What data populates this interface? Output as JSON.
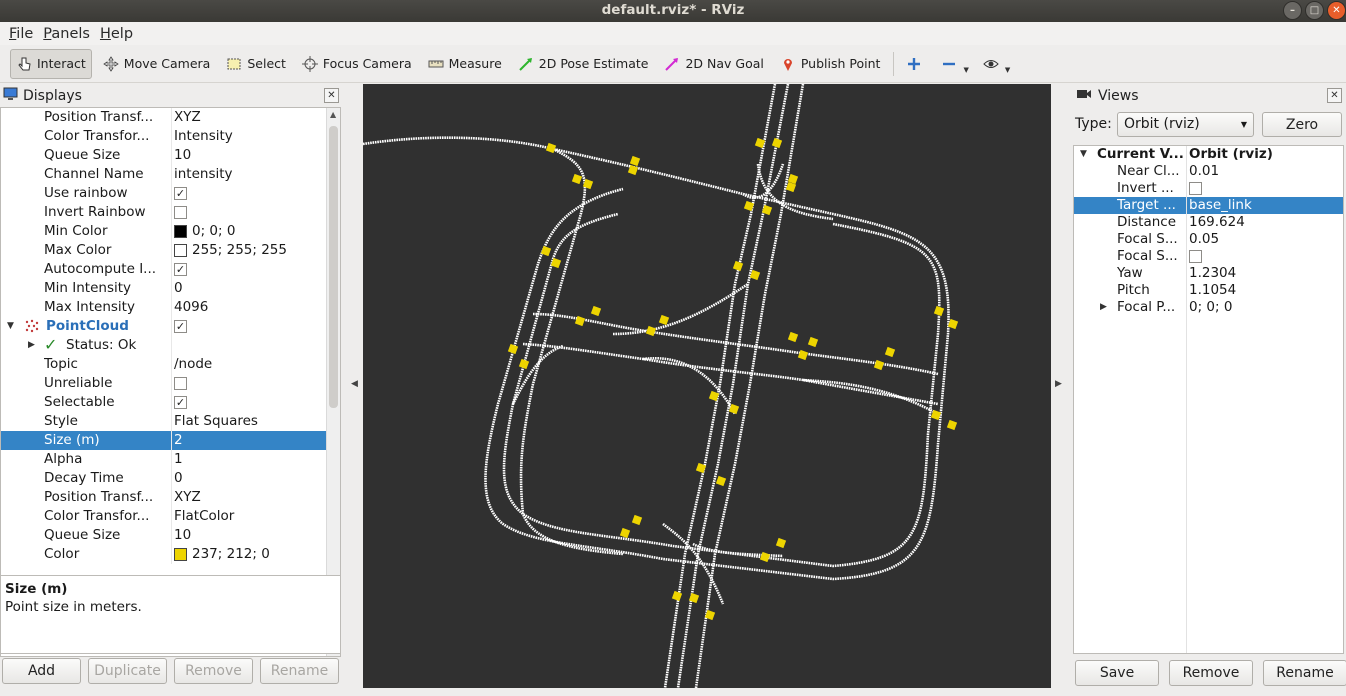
{
  "window": {
    "title": "default.rviz* - RViz"
  },
  "menu": [
    {
      "label": "File",
      "key": "F",
      "rest": "ile"
    },
    {
      "label": "Panels",
      "key": "P",
      "rest": "anels"
    },
    {
      "label": "Help",
      "key": "H",
      "rest": "elp"
    }
  ],
  "toolbar": {
    "tools": [
      {
        "label": "Interact",
        "icon": "hand-pointer-icon",
        "active": true
      },
      {
        "label": "Move Camera",
        "icon": "move-camera-icon"
      },
      {
        "label": "Select",
        "icon": "select-box-icon"
      },
      {
        "label": "Focus Camera",
        "icon": "crosshair-icon"
      },
      {
        "label": "Measure",
        "icon": "ruler-icon"
      },
      {
        "label": "2D Pose Estimate",
        "icon": "green-arrow-icon"
      },
      {
        "label": "2D Nav Goal",
        "icon": "magenta-arrow-icon"
      },
      {
        "label": "Publish Point",
        "icon": "map-pin-icon"
      }
    ]
  },
  "displays": {
    "title": "Displays",
    "rows": [
      {
        "k": "Position Transf...",
        "v": "XYZ"
      },
      {
        "k": "Color Transfor...",
        "v": "Intensity"
      },
      {
        "k": "Queue Size",
        "v": "10"
      },
      {
        "k": "Channel Name",
        "v": "intensity"
      },
      {
        "k": "Use rainbow",
        "check": true
      },
      {
        "k": "Invert Rainbow",
        "check": false
      },
      {
        "k": "Min Color",
        "v": "0; 0; 0",
        "swatch": "#000000"
      },
      {
        "k": "Max Color",
        "v": "255; 255; 255",
        "swatch": "#ffffff"
      },
      {
        "k": "Autocompute I...",
        "check": true
      },
      {
        "k": "Min Intensity",
        "v": "0"
      },
      {
        "k": "Max Intensity",
        "v": "4096"
      },
      {
        "k": "PointCloud",
        "check": true,
        "group": true
      },
      {
        "k": "Status: Ok",
        "status": true
      },
      {
        "k": "Topic",
        "v": "/node"
      },
      {
        "k": "Unreliable",
        "check": false
      },
      {
        "k": "Selectable",
        "check": true
      },
      {
        "k": "Style",
        "v": "Flat Squares"
      },
      {
        "k": "Size (m)",
        "v": "2",
        "selected": true
      },
      {
        "k": "Alpha",
        "v": "1"
      },
      {
        "k": "Decay Time",
        "v": "0"
      },
      {
        "k": "Position Transf...",
        "v": "XYZ"
      },
      {
        "k": "Color Transfor...",
        "v": "FlatColor"
      },
      {
        "k": "Queue Size",
        "v": "10"
      },
      {
        "k": "Color",
        "v": "237; 212; 0",
        "swatch": "#edd400"
      }
    ],
    "description": {
      "title": "Size (m)",
      "text": "Point size in meters."
    },
    "buttons": {
      "add": "Add",
      "duplicate": "Duplicate",
      "remove": "Remove",
      "rename": "Rename"
    }
  },
  "views": {
    "title": "Views",
    "type_label": "Type:",
    "type_value": "Orbit (rviz)",
    "zero": "Zero",
    "header": {
      "k": "Current V...",
      "v": "Orbit (rviz)"
    },
    "rows": [
      {
        "k": "Near Cl...",
        "v": "0.01"
      },
      {
        "k": "Invert ...",
        "check": false
      },
      {
        "k": "Target ...",
        "v": "base_link",
        "selected": true
      },
      {
        "k": "Distance",
        "v": "169.624"
      },
      {
        "k": "Focal S...",
        "v": "0.05"
      },
      {
        "k": "Focal S...",
        "check": false
      },
      {
        "k": "Yaw",
        "v": "1.2304"
      },
      {
        "k": "Pitch",
        "v": "1.1054"
      },
      {
        "k": "Focal P...",
        "v": "0; 0; 0",
        "expandable": true
      }
    ],
    "buttons": {
      "save": "Save",
      "remove": "Remove",
      "rename": "Rename"
    }
  },
  "colors": {
    "viewport_bg": "#303030",
    "selection": "#3484c6",
    "points": "#edd400",
    "lanes": "#ffffff"
  }
}
